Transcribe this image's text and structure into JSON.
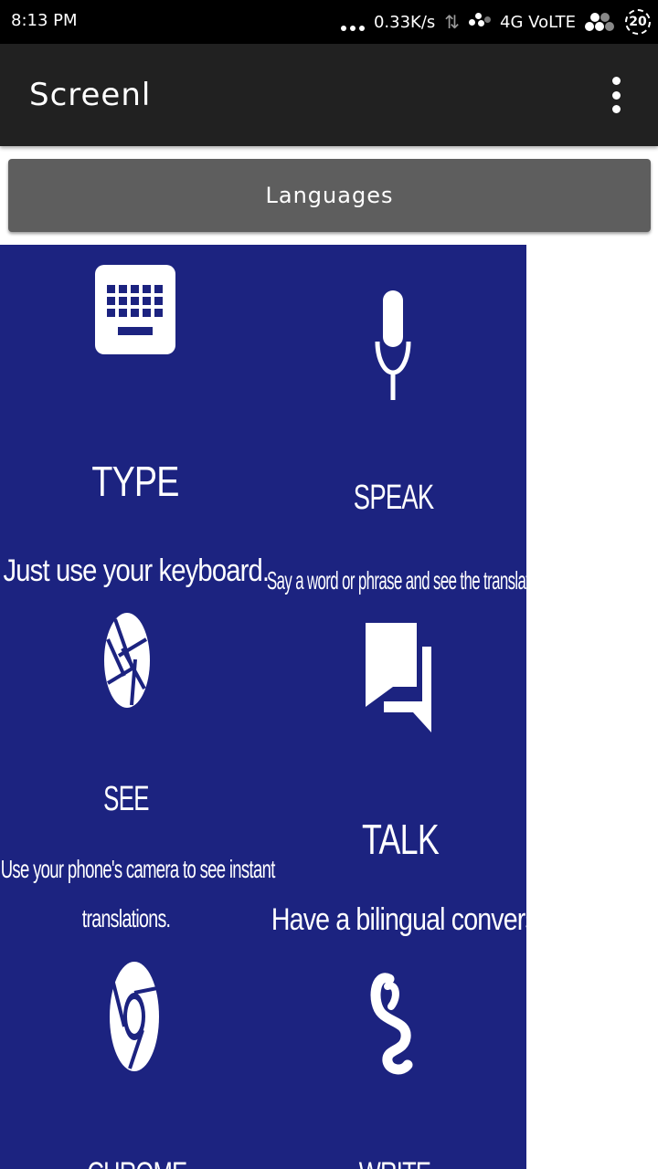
{
  "status_bar": {
    "time": "8:13 PM",
    "speed": "0.33K/s",
    "network": "4G VoLTE",
    "battery": "20"
  },
  "app_bar": {
    "title": "Screenl"
  },
  "languages_button": {
    "label": "Languages"
  },
  "features": {
    "type": {
      "title": "TYPE",
      "description": "Just use your keyboard."
    },
    "speak": {
      "title": "SPEAK",
      "description": "Say a word or phrase and see the translation."
    },
    "see": {
      "title": "SEE",
      "description_line1": "Use your phone's camera to see instant",
      "description_line2": "translations."
    },
    "talk": {
      "title": "TALK",
      "description": "Have a bilingual conversation."
    },
    "chrome": {
      "title": "CHROME"
    },
    "write": {
      "title": "WRITE"
    }
  },
  "colors": {
    "panel_background": "#1c2380",
    "app_bar": "#212121",
    "button": "#5e5e5e"
  }
}
